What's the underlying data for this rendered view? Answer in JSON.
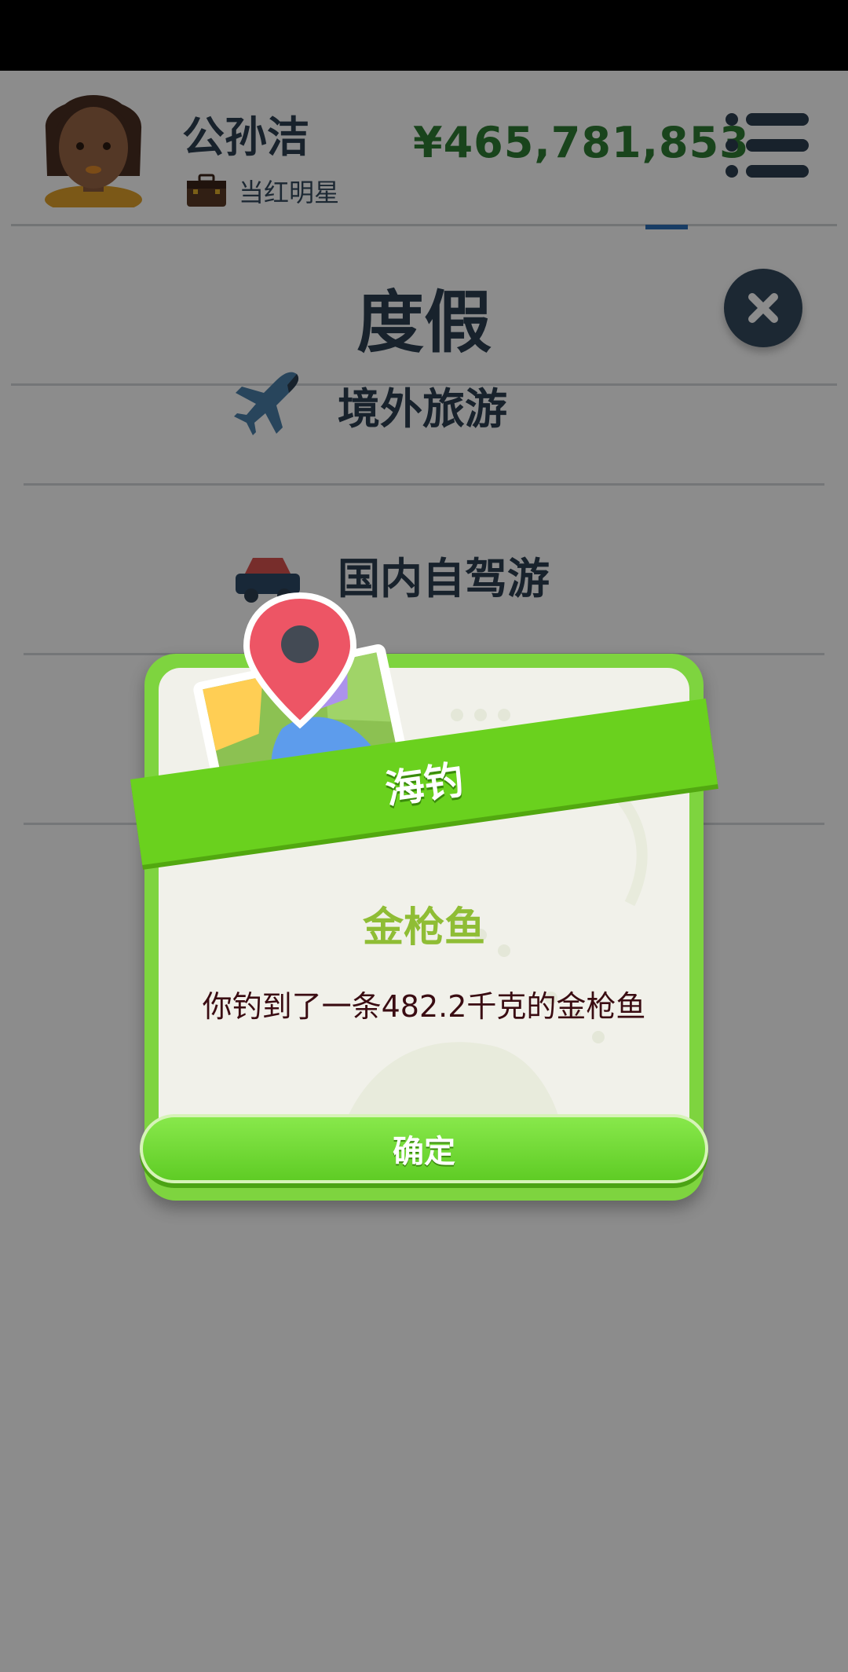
{
  "header": {
    "player_name": "公孙洁",
    "job_title": "当红明星",
    "money": "¥465,781,853"
  },
  "page": {
    "title": "度假"
  },
  "list": {
    "items": [
      {
        "label": "境外旅游",
        "icon": "airplane-icon"
      },
      {
        "label": "国内自驾游",
        "icon": "car-icon"
      }
    ]
  },
  "dialog": {
    "header": "海钓",
    "result_title": "金枪鱼",
    "message": "你钓到了一条482.2千克的金枪鱼",
    "confirm_label": "确定"
  },
  "colors": {
    "money": "#2f7d34",
    "dialog_frame": "#7ed43f",
    "ribbon": "#6ad11e",
    "result_title": "#8fbd35",
    "message": "#3a0c12"
  }
}
